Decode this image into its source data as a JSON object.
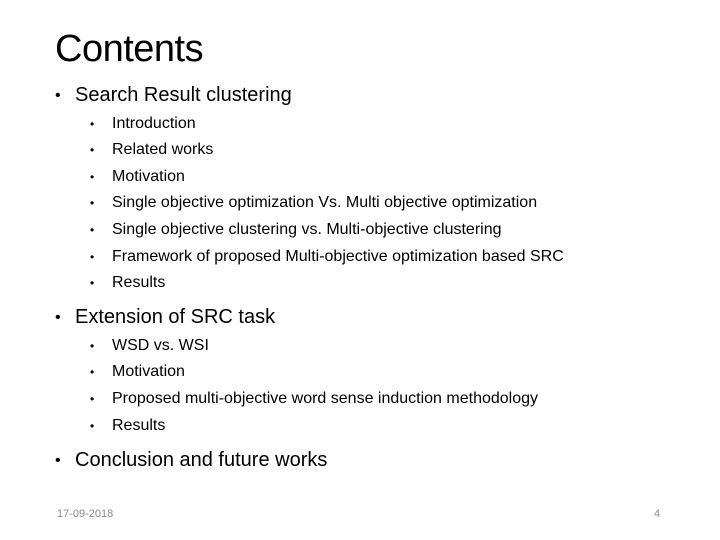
{
  "slide": {
    "title": "Contents",
    "sections": [
      {
        "label": "Search Result clustering",
        "items": [
          "Introduction",
          "Related works",
          "Motivation",
          "Single objective optimization Vs. Multi objective optimization",
          "Single objective clustering vs. Multi-objective clustering",
          "Framework of proposed Multi-objective optimization based SRC",
          "Results"
        ]
      },
      {
        "label": "Extension of SRC task",
        "items": [
          "WSD vs. WSI",
          "Motivation",
          "Proposed multi-objective word sense induction methodology",
          "Results"
        ]
      },
      {
        "label": "Conclusion and future works",
        "items": []
      }
    ],
    "bullet": "•",
    "footer": {
      "date": "17-09-2018",
      "page_number": "4"
    }
  }
}
